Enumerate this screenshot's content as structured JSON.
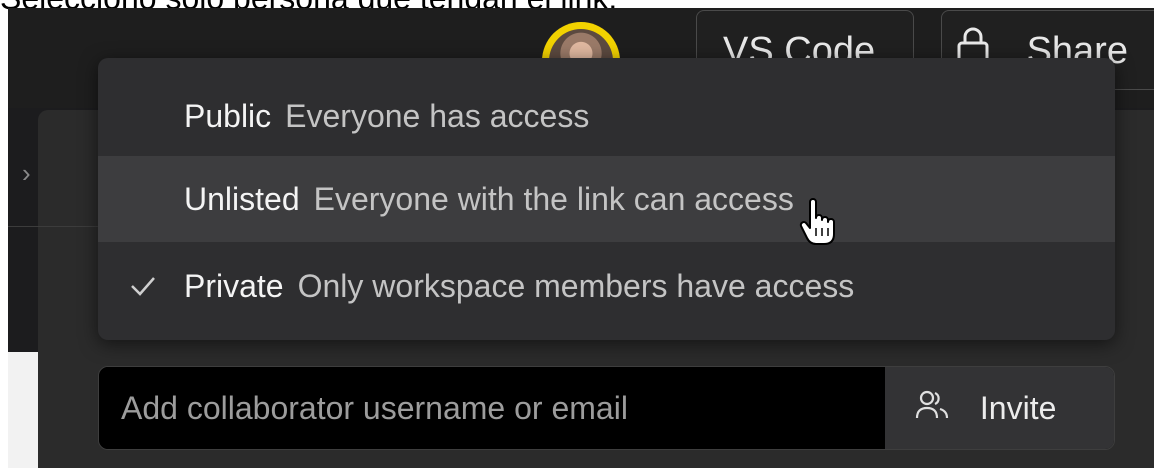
{
  "caption": "Selecciono solo persona que tengan el link.",
  "header": {
    "vscode_label": "VS Code",
    "share_label": "Share"
  },
  "visibility_menu": {
    "items": [
      {
        "title": "Public",
        "description": "Everyone has access",
        "selected": false,
        "hovered": false
      },
      {
        "title": "Unlisted",
        "description": "Everyone with the link can access",
        "selected": false,
        "hovered": true
      },
      {
        "title": "Private",
        "description": "Only workspace members have access",
        "selected": true,
        "hovered": false
      }
    ]
  },
  "invite": {
    "placeholder": "Add collaborator username or email",
    "button_label": "Invite"
  },
  "icons": {
    "selected_marker": "check-icon",
    "share": "lock-icon",
    "invite": "users-icon",
    "pointer": "hand-cursor-icon"
  },
  "colors": {
    "background": "#1c1c1e",
    "menu": "#2e2e30",
    "menu_hover": "#3d3d3f",
    "avatar_ring": "#f2d200"
  }
}
